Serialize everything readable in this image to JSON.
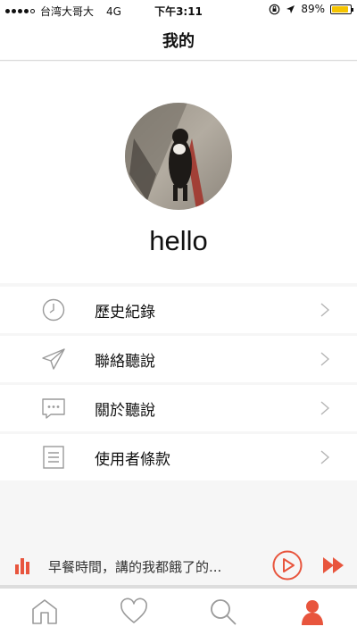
{
  "status_bar": {
    "carrier": "台湾大哥大",
    "network": "4G",
    "time": "下午3:11",
    "battery": "89%",
    "battery_level": 0.89
  },
  "header": {
    "title": "我的"
  },
  "profile": {
    "username": "hello"
  },
  "menu": {
    "items": [
      {
        "label": "歷史紀錄",
        "icon": "history-clock-icon"
      },
      {
        "label": "聯絡聽說",
        "icon": "send-plane-icon"
      },
      {
        "label": "關於聽說",
        "icon": "chat-bubble-icon"
      },
      {
        "label": "使用者條款",
        "icon": "document-icon"
      }
    ]
  },
  "player": {
    "track_title": "早餐時間，講的我都餓了的..."
  },
  "tabs": [
    {
      "icon": "home-icon"
    },
    {
      "icon": "heart-icon"
    },
    {
      "icon": "search-icon"
    },
    {
      "icon": "user-icon",
      "active": true
    }
  ],
  "colors": {
    "accent": "#e8553d",
    "icon_gray": "#9a9a9a",
    "battery": "#f5c400"
  }
}
